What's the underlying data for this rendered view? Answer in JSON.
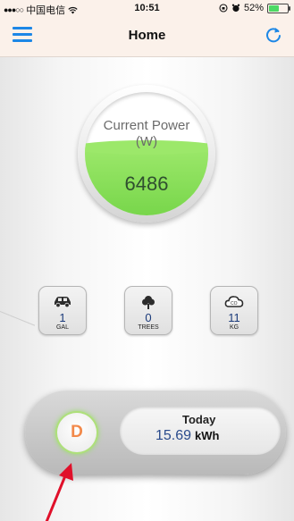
{
  "status_bar": {
    "carrier": "中国电信",
    "time": "10:51",
    "battery": "52%"
  },
  "nav": {
    "title": "Home"
  },
  "gauge": {
    "label": "Current Power",
    "unit": "(W)",
    "value": "6486",
    "fill_fraction": 0.55
  },
  "tiles": [
    {
      "icon": "car-icon",
      "value": "1",
      "label": "GAL"
    },
    {
      "icon": "tree-icon",
      "value": "0",
      "label": "TREES"
    },
    {
      "icon": "co2-cloud-icon",
      "value": "11",
      "label": "KG"
    }
  ],
  "today": {
    "badge": "D",
    "label": "Today",
    "value": "15.69",
    "unit": "kWh"
  },
  "colors": {
    "accent_blue": "#1c87e6",
    "gauge_green": "#86dc55",
    "badge_orange": "#f2894a",
    "annotation_red": "#e0102a"
  }
}
